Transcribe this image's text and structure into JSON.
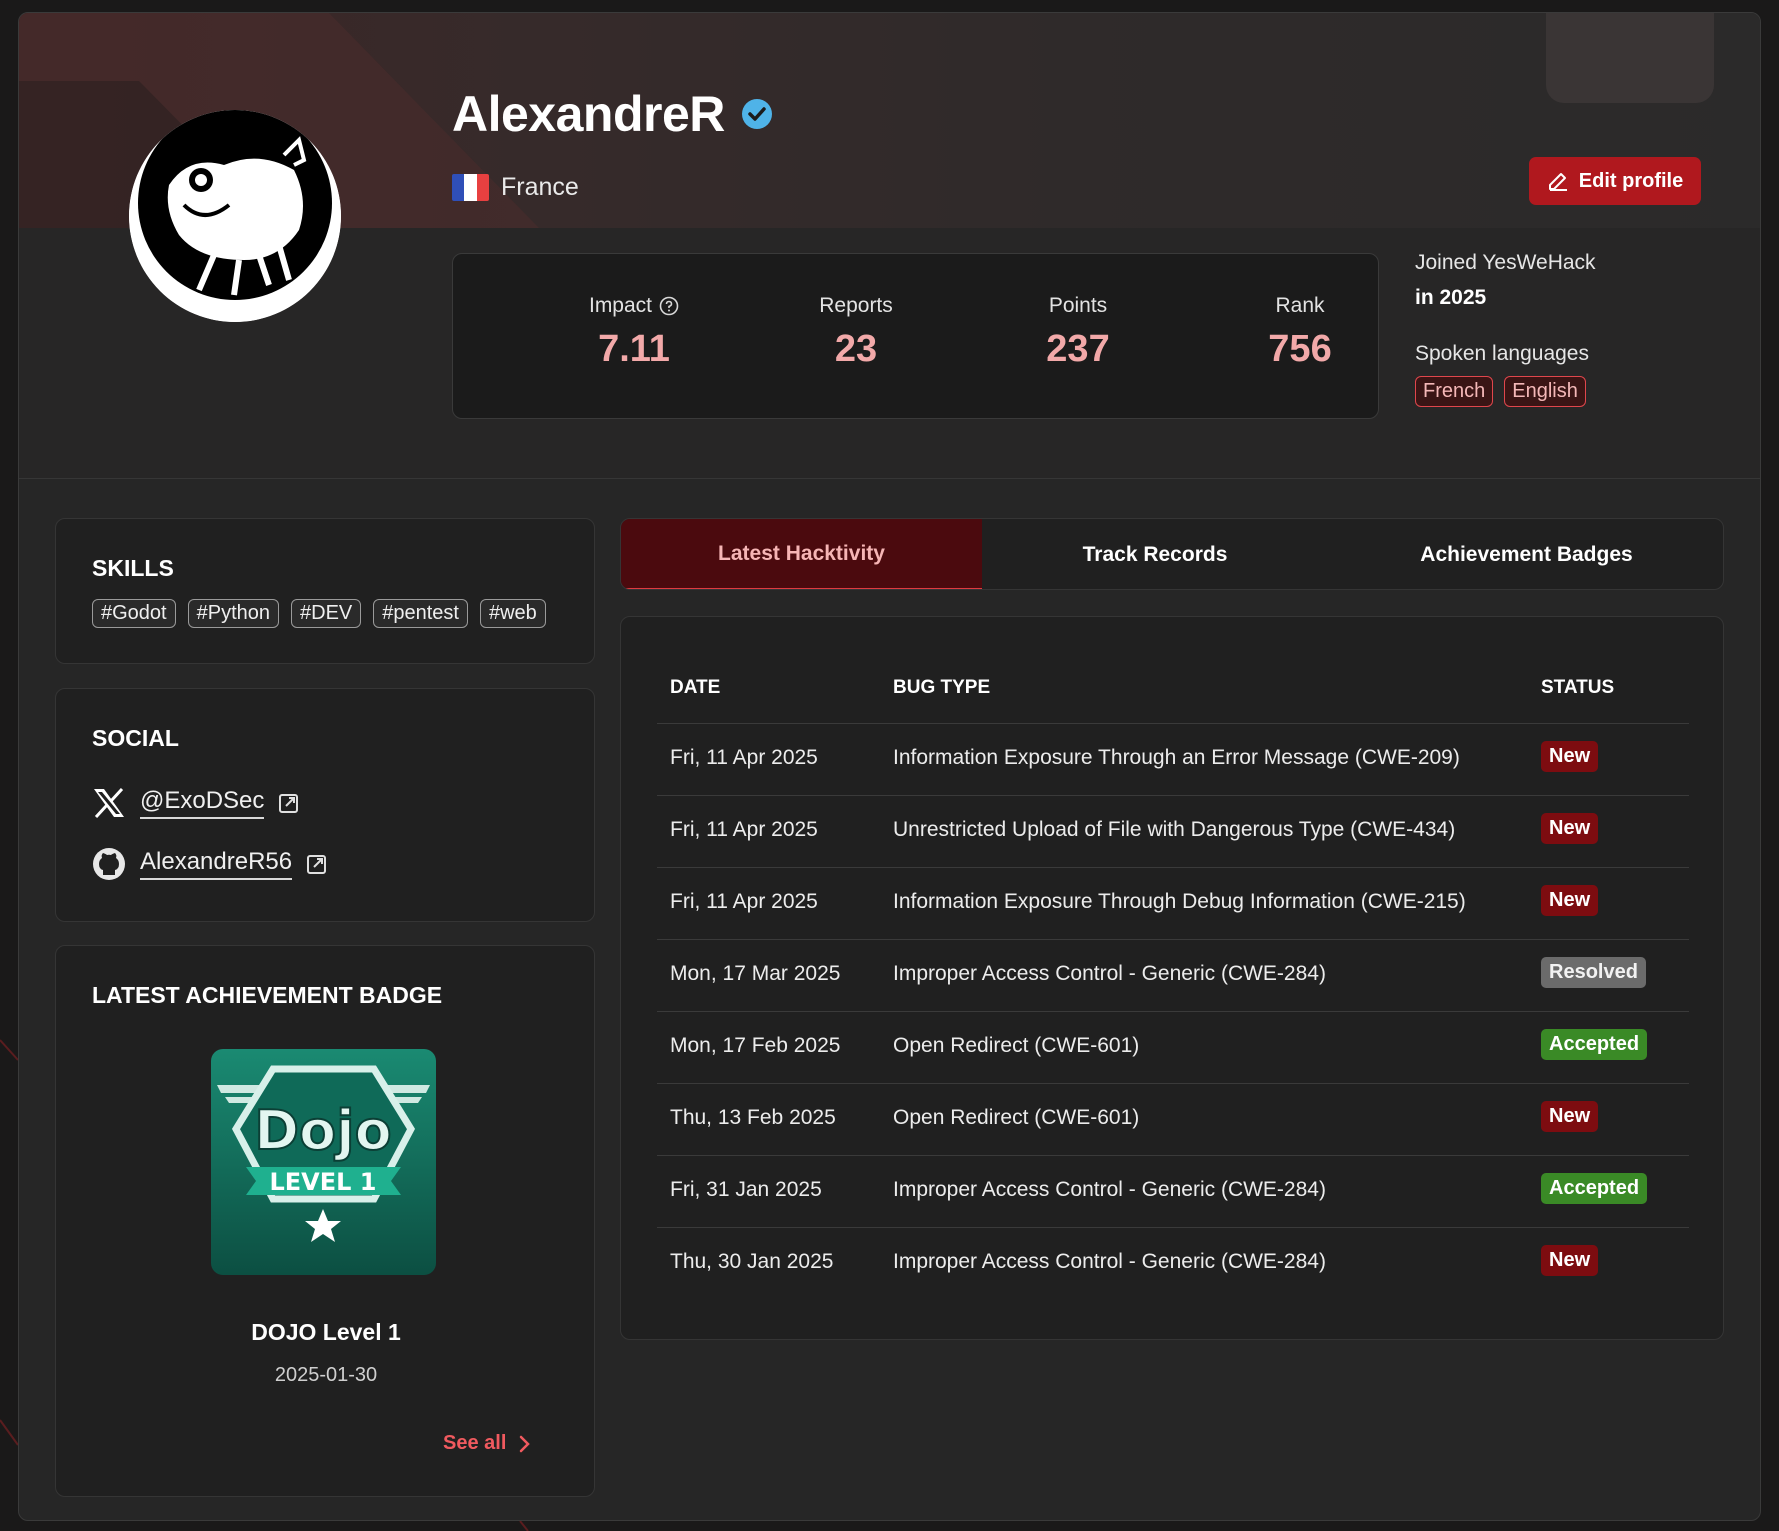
{
  "profile": {
    "name": "AlexandreR",
    "country": "France",
    "edit_label": "Edit profile",
    "joined_line1": "Joined YesWeHack",
    "joined_line2": "in 2025",
    "spoken_label": "Spoken languages",
    "languages": [
      "French",
      "English"
    ]
  },
  "stats": {
    "impact": {
      "label": "Impact",
      "value": "7.11"
    },
    "reports": {
      "label": "Reports",
      "value": "23"
    },
    "points": {
      "label": "Points",
      "value": "237"
    },
    "rank": {
      "label": "Rank",
      "value": "756"
    }
  },
  "skills": {
    "title": "SKILLS",
    "items": [
      "#Godot",
      "#Python",
      "#DEV",
      "#pentest",
      "#web"
    ]
  },
  "social": {
    "title": "SOCIAL",
    "x_handle": "@ExoDSec",
    "github_handle": "AlexandreR56"
  },
  "latest_badge": {
    "title": "LATEST ACHIEVEMENT BADGE",
    "badge_text": "Dojo",
    "badge_level": "LEVEL 1",
    "name": "DOJO Level 1",
    "date": "2025-01-30",
    "see_all": "See all"
  },
  "tabs": [
    "Latest Hacktivity",
    "Track Records",
    "Achievement Badges"
  ],
  "table": {
    "headers": {
      "date": "DATE",
      "bug_type": "BUG TYPE",
      "status": "STATUS"
    },
    "rows": [
      {
        "date": "Fri, 11 Apr 2025",
        "bug_type": "Information Exposure Through an Error Message (CWE-209)",
        "status": "New"
      },
      {
        "date": "Fri, 11 Apr 2025",
        "bug_type": "Unrestricted Upload of File with Dangerous Type (CWE-434)",
        "status": "New"
      },
      {
        "date": "Fri, 11 Apr 2025",
        "bug_type": "Information Exposure Through Debug Information (CWE-215)",
        "status": "New"
      },
      {
        "date": "Mon, 17 Mar 2025",
        "bug_type": "Improper Access Control - Generic (CWE-284)",
        "status": "Resolved"
      },
      {
        "date": "Mon, 17 Feb 2025",
        "bug_type": "Open Redirect (CWE-601)",
        "status": "Accepted"
      },
      {
        "date": "Thu, 13 Feb 2025",
        "bug_type": "Open Redirect (CWE-601)",
        "status": "New"
      },
      {
        "date": "Fri, 31 Jan 2025",
        "bug_type": "Improper Access Control - Generic (CWE-284)",
        "status": "Accepted"
      },
      {
        "date": "Thu, 30 Jan 2025",
        "bug_type": "Improper Access Control - Generic (CWE-284)",
        "status": "New"
      }
    ]
  },
  "colors": {
    "accent": "#b0181e",
    "stat_value": "#f2a9a9",
    "status_new": "#7d0c10",
    "status_resolved": "#6b6b6b",
    "status_accepted": "#3a8a26",
    "verified": "#4fb3e8"
  },
  "icons": [
    "verified-icon",
    "france-flag-icon",
    "pencil-icon",
    "help-circle-icon",
    "x-logo-icon",
    "github-icon",
    "external-link-icon",
    "chevron-right-icon"
  ]
}
